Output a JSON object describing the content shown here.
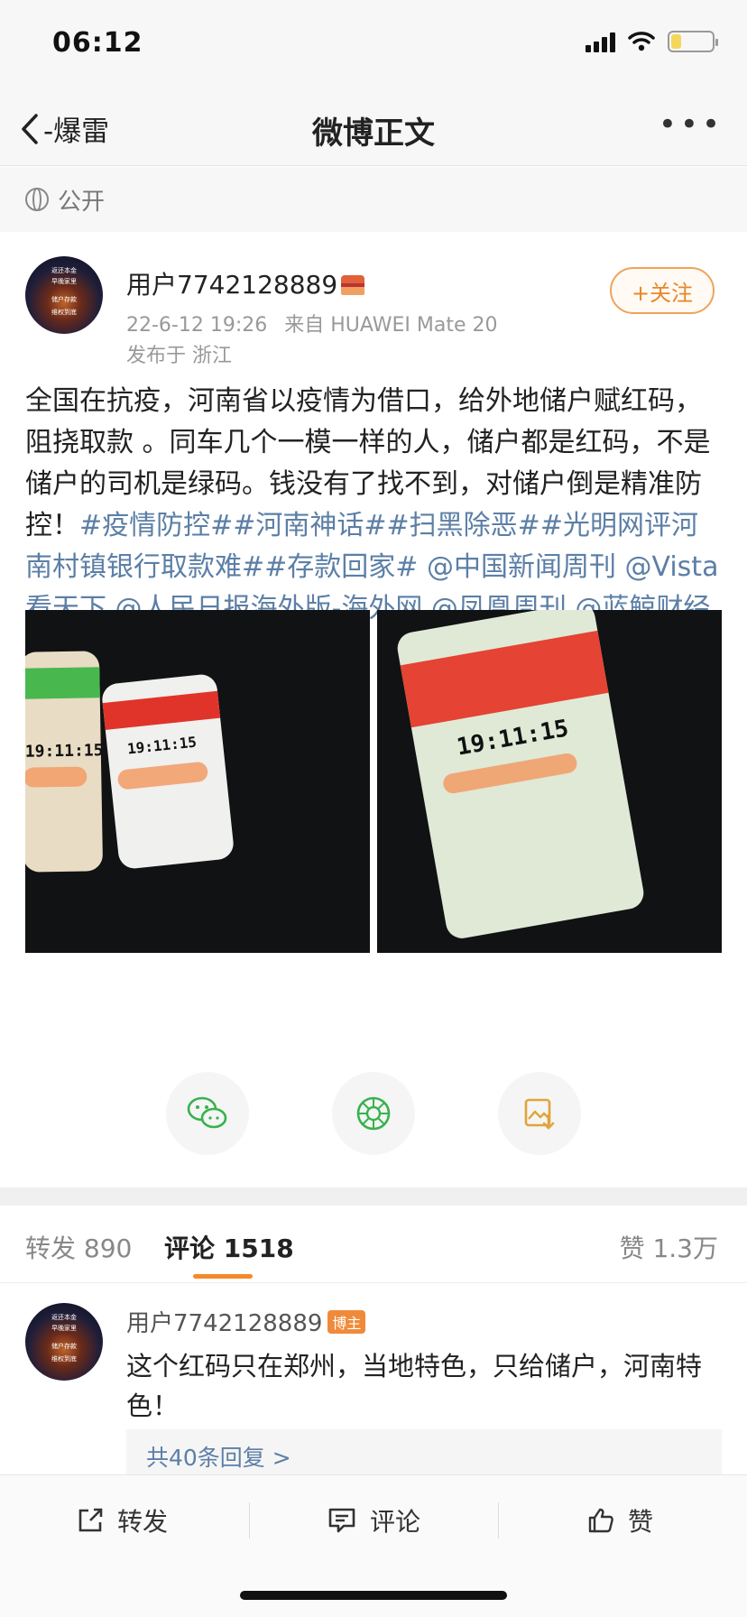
{
  "status_bar": {
    "time": "06:12",
    "battery_level": 0.25
  },
  "nav": {
    "back_label": "-爆雷",
    "title": "微博正文",
    "more_icon": "more-dots-icon"
  },
  "visibility": {
    "label": "公开",
    "icon": "globe-icon"
  },
  "post": {
    "username": "用户7742128889",
    "avatar_text": [
      "返还本金",
      "早晚家里",
      "储户存款",
      "维权到底"
    ],
    "date": "22-6-12 19:26",
    "source": "来自 HUAWEI Mate 20",
    "location": "发布于 浙江",
    "follow_label": "+关注",
    "text_plain": "全国在抗疫，河南省以疫情为借口，给外地储户赋红码，阻挠取款 。同车几个一模一样的人，储户都是红码，不是储户的司机是绿码。钱没有了找不到，对储户倒是精准防控！",
    "tags": "#疫情防控##河南神话##扫黑除恶##光明网评河南村镇银行取款难##存款回家# @中国新闻周刊 @Vista看天下 @人民日报海外版-海外网 @凤凰周刊 @蓝鲸财经记者工作平台",
    "image1_time_a": "19:11:15",
    "image1_time_b": "19:11:15",
    "image2_time": "19:11:15"
  },
  "share": {
    "wechat_icon": "wechat-icon",
    "moments_icon": "moments-icon",
    "save_icon": "save-image-icon"
  },
  "tabs": {
    "repost_label": "转发 890",
    "comment_label": "评论 1518",
    "like_label": "赞 1.3万"
  },
  "comment": {
    "username": "用户7742128889",
    "badge": "博主",
    "text": "这个红码只在郑州，当地特色，只给储户，河南特色！",
    "replies": "共40条回复 >"
  },
  "bottom_bar": {
    "repost": "转发",
    "comment": "评论",
    "like": "赞"
  }
}
